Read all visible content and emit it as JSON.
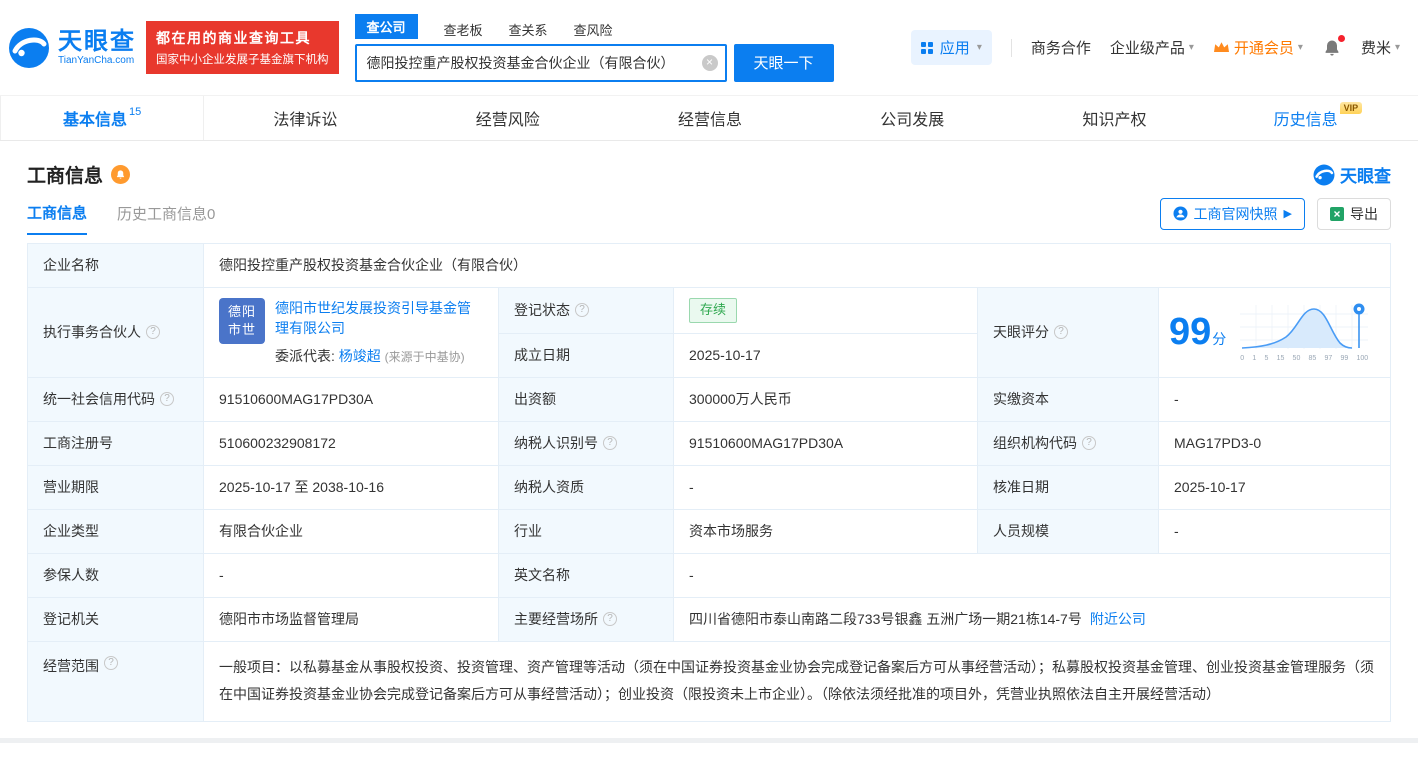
{
  "colors": {
    "brand_blue": "#0b7ef0",
    "promo_red": "#e8382d",
    "vip_orange": "#ff7a00",
    "status_green": "#2fa84f",
    "excel_green": "#21a366"
  },
  "icons": {
    "caret_down": "▾",
    "clear": "×",
    "arrow_right": "▶",
    "question": "?"
  },
  "header": {
    "logo_title": "天眼查",
    "logo_sub": "TianYanCha.com",
    "promo_line1": "都在用的商业查询工具",
    "promo_line2": "国家中小企业发展子基金旗下机构",
    "search_tabs": [
      {
        "label": "查公司"
      },
      {
        "label": "查老板"
      },
      {
        "label": "查关系"
      },
      {
        "label": "查风险"
      }
    ],
    "search_value": "德阳投控重产股权投资基金合伙企业（有限合伙）",
    "search_button": "天眼一下",
    "menu": {
      "apps": "应用",
      "coop": "商务合作",
      "enterprise": "企业级产品",
      "vip": "开通会员",
      "user": "费米"
    }
  },
  "nav": {
    "tabs": [
      {
        "label": "基本信息",
        "count": "15"
      },
      {
        "label": "法律诉讼"
      },
      {
        "label": "经营风险"
      },
      {
        "label": "经营信息"
      },
      {
        "label": "公司发展"
      },
      {
        "label": "知识产权"
      },
      {
        "label": "历史信息",
        "badge": "VIP"
      }
    ]
  },
  "section": {
    "title": "工商信息",
    "brand": "天眼查",
    "subtab_active": "工商信息",
    "subtab_history": "历史工商信息0",
    "snapshot_button": "工商官网快照",
    "export_button": "导出"
  },
  "table": {
    "q_name": "企业名称",
    "v_name": "德阳投控重产股权投资基金合伙企业（有限合伙）",
    "q_partner": "执行事务合伙人",
    "partner_logo_1": "德阳",
    "partner_logo_2": "市世",
    "partner_name": "德阳市世纪发展投资引导基金管理有限公司",
    "rep_label": "委派代表:",
    "rep_name": "杨竣超",
    "rep_source": "(来源于中基协)",
    "q_status": "登记状态",
    "v_status": "存续",
    "q_score": "天眼评分",
    "score": "99",
    "score_unit": "分",
    "score_axis": [
      "0",
      "1",
      "5",
      "15",
      "50",
      "85",
      "97",
      "99",
      "100"
    ],
    "q_est": "成立日期",
    "v_est": "2025-10-17",
    "q_credit": "统一社会信用代码",
    "v_credit": "91510600MAG17PD30A",
    "q_capital": "出资额",
    "v_capital": "300000万人民币",
    "q_paid": "实缴资本",
    "v_paid": "-",
    "q_regno": "工商注册号",
    "v_regno": "510600232908172",
    "q_taxid": "纳税人识别号",
    "v_taxid": "91510600MAG17PD30A",
    "q_orgcode": "组织机构代码",
    "v_orgcode": "MAG17PD3-0",
    "q_term": "营业期限",
    "v_term": "2025-10-17 至 2038-10-16",
    "q_taxq": "纳税人资质",
    "v_taxq": "-",
    "q_approve": "核准日期",
    "v_approve": "2025-10-17",
    "q_type": "企业类型",
    "v_type": "有限合伙企业",
    "q_industry": "行业",
    "v_industry": "资本市场服务",
    "q_staff": "人员规模",
    "v_staff": "-",
    "q_insured": "参保人数",
    "v_insured": "-",
    "q_en": "英文名称",
    "v_en": "-",
    "q_authority": "登记机关",
    "v_authority": "德阳市市场监督管理局",
    "q_address": "主要经营场所",
    "v_address": "四川省德阳市泰山南路二段733号银鑫 五洲广场一期21栋14-7号",
    "address_link": "附近公司",
    "q_scope": "经营范围",
    "v_scope": "一般项目：以私募基金从事股权投资、投资管理、资产管理等活动（须在中国证券投资基金业协会完成登记备案后方可从事经营活动）；私募股权投资基金管理、创业投资基金管理服务（须在中国证券投资基金业协会完成登记备案后方可从事经营活动）；创业投资（限投资未上市企业）。（除依法须经批准的项目外，凭营业执照依法自主开展经营活动）"
  }
}
